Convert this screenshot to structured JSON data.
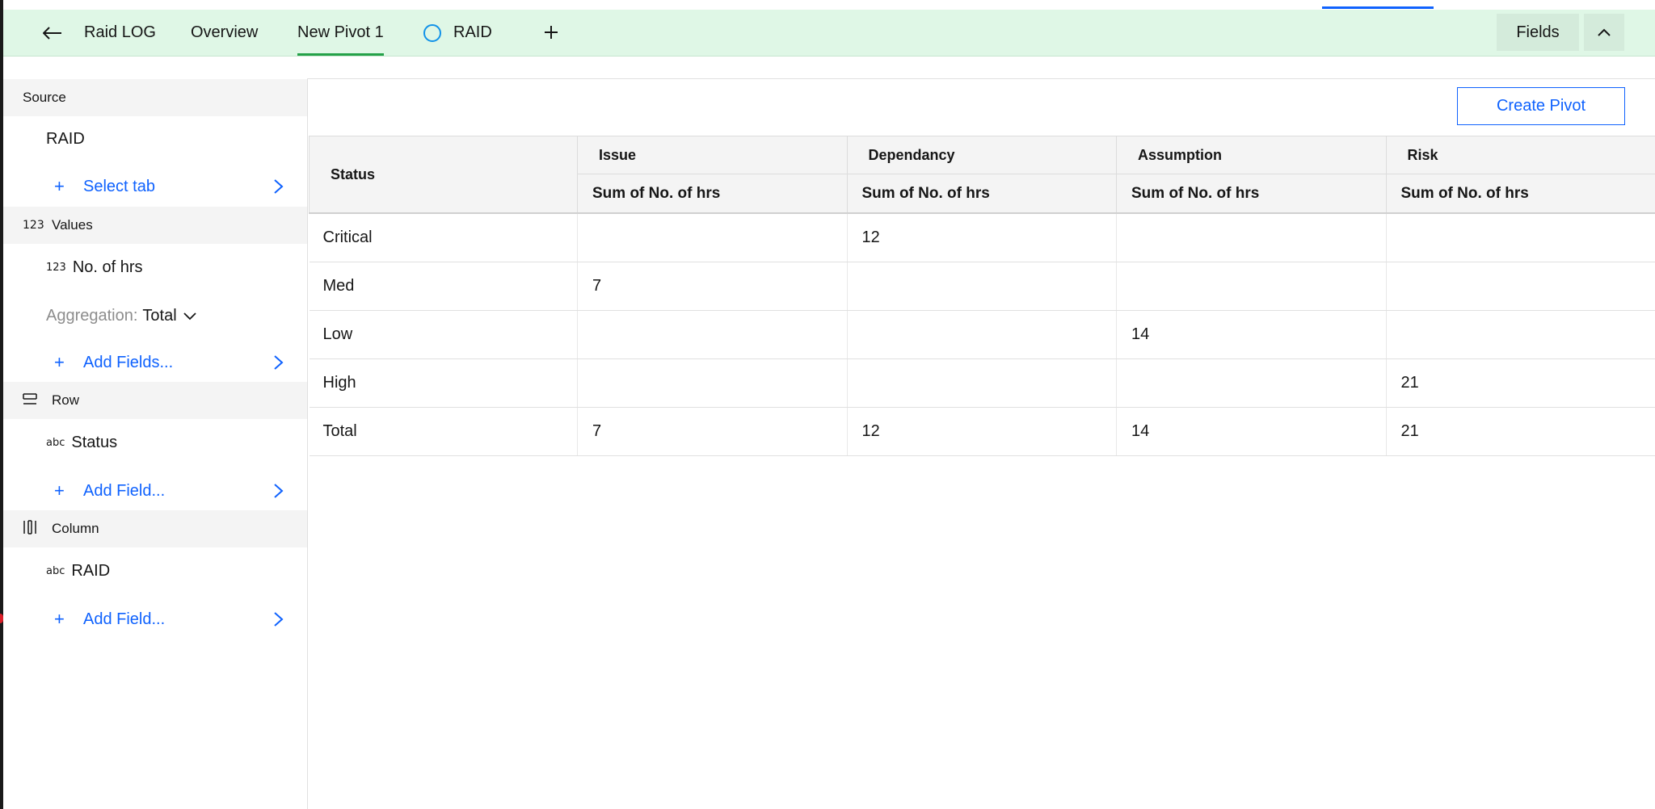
{
  "colors": {
    "header_bg": "#dff7e6",
    "accent_blue": "#0f62fe",
    "tab_underline": "#24a148"
  },
  "header": {
    "back_icon": "arrow-left-icon",
    "tabs": [
      {
        "label": "Raid LOG",
        "active": false
      },
      {
        "label": "Overview",
        "active": false
      },
      {
        "label": "New Pivot 1",
        "active": true
      },
      {
        "label": "RAID",
        "active": false,
        "icon": "circle-icon"
      }
    ],
    "add_tab_icon": "plus-icon",
    "fields_label": "Fields",
    "collapse_icon": "chevron-up-icon"
  },
  "sidebar": {
    "source": {
      "title": "Source",
      "value": "RAID",
      "add_label": "Select tab"
    },
    "values": {
      "title": "Values",
      "icon": "123",
      "field": {
        "type": "123",
        "label": "No. of hrs"
      },
      "aggregation_key": "Aggregation:",
      "aggregation_value": "Total",
      "add_label": "Add Fields..."
    },
    "row": {
      "title": "Row",
      "field": {
        "type": "abc",
        "label": "Status"
      },
      "add_label": "Add Field..."
    },
    "column": {
      "title": "Column",
      "field": {
        "type": "abc",
        "label": "RAID"
      },
      "add_label": "Add Field..."
    }
  },
  "main": {
    "create_label": "Create Pivot",
    "table": {
      "row_header": "Status",
      "columns": [
        "Issue",
        "Dependancy",
        "Assumption",
        "Risk"
      ],
      "measure": "Sum of No. of hrs",
      "rows": [
        {
          "label": "Critical",
          "values": [
            "",
            "12",
            "",
            ""
          ]
        },
        {
          "label": "Med",
          "values": [
            "7",
            "",
            "",
            ""
          ]
        },
        {
          "label": "Low",
          "values": [
            "",
            "",
            "14",
            ""
          ]
        },
        {
          "label": "High",
          "values": [
            "",
            "",
            "",
            "21"
          ]
        },
        {
          "label": "Total",
          "values": [
            "7",
            "12",
            "14",
            "21"
          ]
        }
      ]
    }
  }
}
